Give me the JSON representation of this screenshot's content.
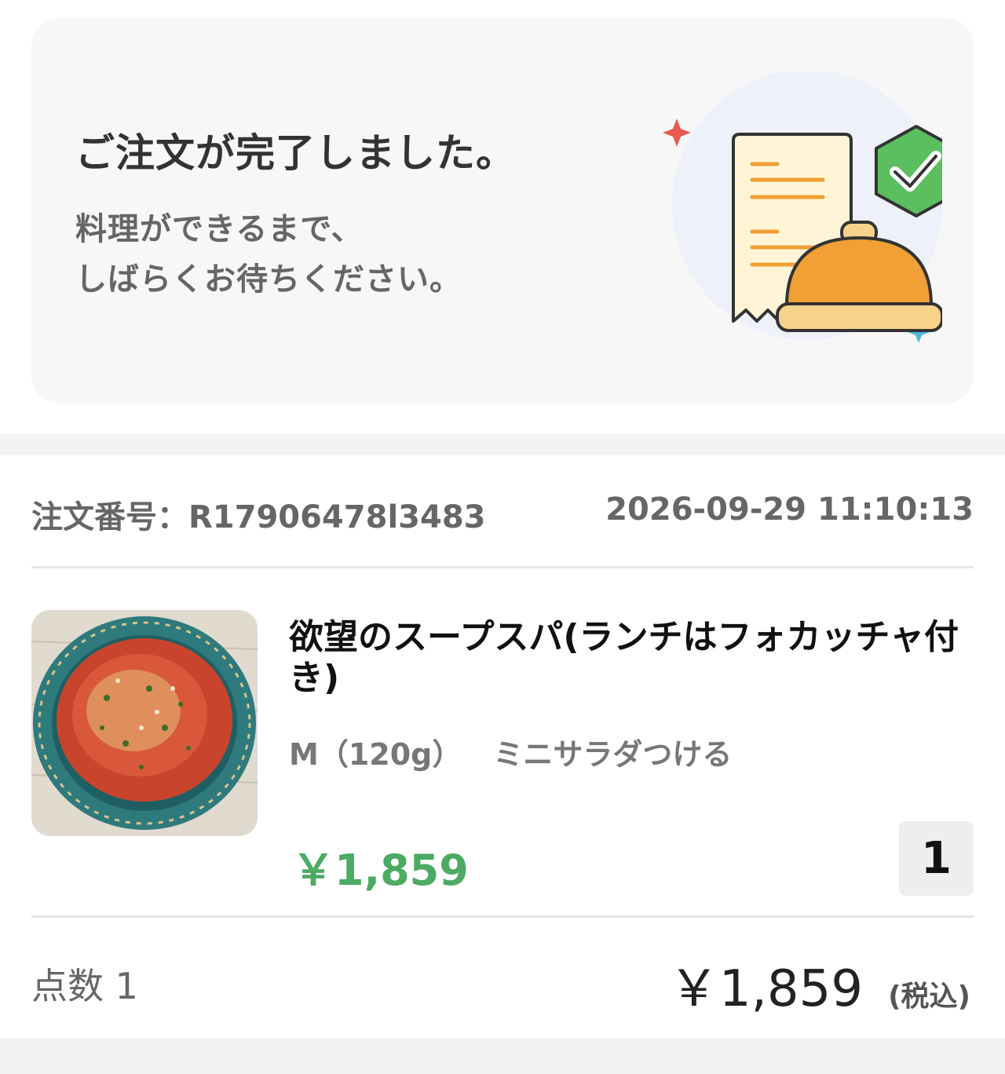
{
  "banner": {
    "title": "ご注文が完了しました。",
    "subtitle_line1": "料理ができるまで、",
    "subtitle_line2": "しばらくお待ちください。",
    "illustration_icons": [
      "receipt-icon",
      "serving-cloche-icon",
      "check-badge-icon",
      "sparkle-icon"
    ]
  },
  "order": {
    "number_label": "注文番号：R17906478l3483",
    "datetime": "2026-09-29 11:10:13"
  },
  "item": {
    "name": "欲望のスープスパ(ランチはフォカッチャ付き)",
    "option_size": "M（120g）",
    "option_extra": "ミニサラダつける",
    "price": "￥1,859",
    "quantity": "1"
  },
  "summary": {
    "count": "点数 1",
    "total": "￥1,859",
    "tax_note": "(税込)"
  },
  "colors": {
    "price_green": "#4caa63",
    "badge_green": "#5bbf5f",
    "cloche_orange": "#f0a035",
    "sparkle_red": "#e85a4f",
    "sparkle_blue": "#4fb8d8"
  }
}
